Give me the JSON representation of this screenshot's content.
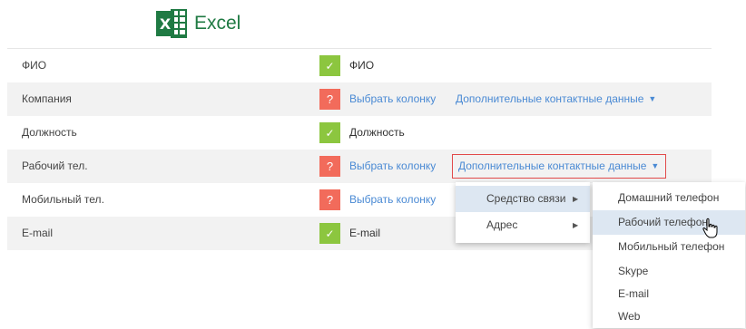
{
  "header": {
    "logo_letter": "X",
    "app_name": "Excel"
  },
  "rows": [
    {
      "field": "ФИО",
      "status": "ok",
      "status_glyph": "✓",
      "mapped": "ФИО",
      "extra": ""
    },
    {
      "field": "Компания",
      "status": "unmapped",
      "status_glyph": "?",
      "mapped": "Выбрать колонку",
      "extra": "Дополнительные контактные данные"
    },
    {
      "field": "Должность",
      "status": "ok",
      "status_glyph": "✓",
      "mapped": "Должность",
      "extra": ""
    },
    {
      "field": "Рабочий тел.",
      "status": "unmapped",
      "status_glyph": "?",
      "mapped": "Выбрать колонку",
      "extra": "Дополнительные контактные данные"
    },
    {
      "field": "Мобильный тел.",
      "status": "unmapped",
      "status_glyph": "?",
      "mapped": "Выбрать колонку",
      "extra": ""
    },
    {
      "field": "E-mail",
      "status": "ok",
      "status_glyph": "✓",
      "mapped": "E-mail",
      "extra": ""
    }
  ],
  "menu": {
    "items": [
      {
        "label": "Средство связи",
        "selected": true
      },
      {
        "label": "Адрес",
        "selected": false
      }
    ]
  },
  "submenu": {
    "items": [
      {
        "label": "Домашний телефон",
        "selected": false
      },
      {
        "label": "Рабочий телефон",
        "selected": true
      },
      {
        "label": "Мобильный телефон",
        "selected": false
      },
      {
        "label": "Skype",
        "selected": false
      },
      {
        "label": "E-mail",
        "selected": false
      },
      {
        "label": "Web",
        "selected": false
      }
    ]
  },
  "colors": {
    "accent_link": "#4a8ad4",
    "ok": "#8cc63f",
    "unmapped": "#f26b5b",
    "excel_green": "#1f7a43",
    "highlight_border": "#e24a4a"
  }
}
